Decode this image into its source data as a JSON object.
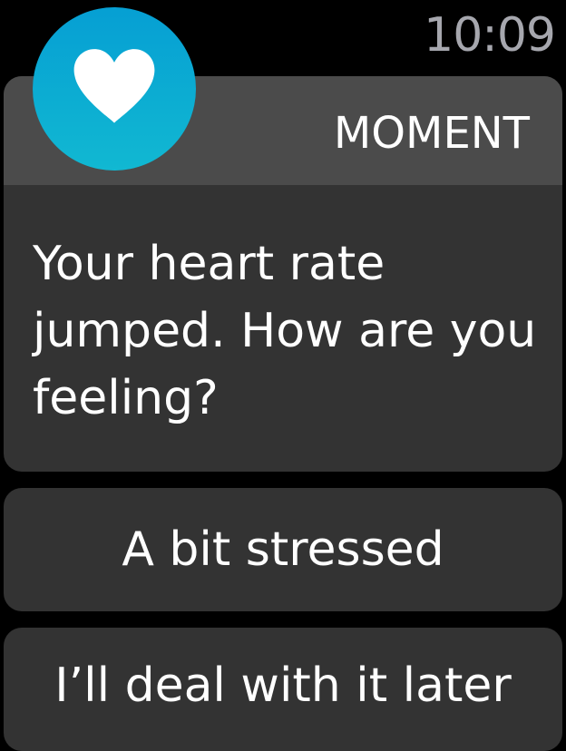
{
  "status": {
    "time": "10:09"
  },
  "notification": {
    "app_name": "MOMENT",
    "app_icon": "heart-icon",
    "message": "Your heart rate jumped. How are you feeling?"
  },
  "actions": [
    {
      "label": "A bit stressed"
    },
    {
      "label": "I’ll deal with it later"
    }
  ],
  "colors": {
    "background": "#000000",
    "card": "#333333",
    "card_header": "#4b4b4b",
    "icon_gradient_top": "#069fd3",
    "icon_gradient_bottom": "#11b8d2",
    "time": "#a6a7ae"
  }
}
